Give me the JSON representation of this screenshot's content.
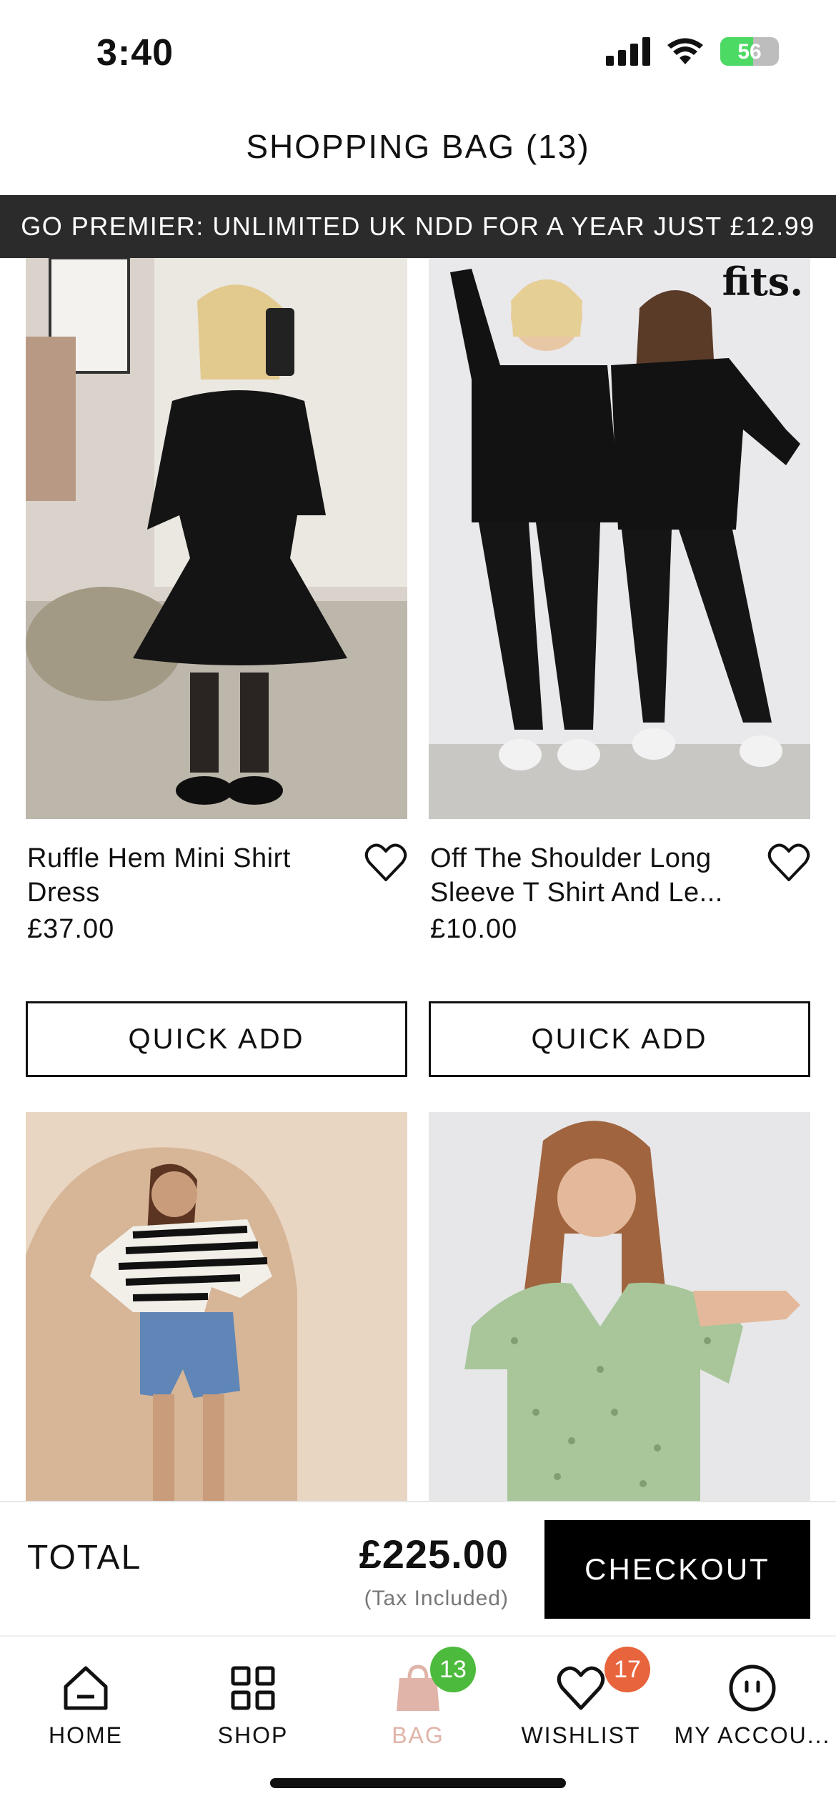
{
  "status": {
    "time": "3:40",
    "battery": "56"
  },
  "header": {
    "title": "SHOPPING BAG (13)"
  },
  "promo": {
    "text": "GO PREMIER: UNLIMITED UK NDD FOR A YEAR JUST £12.99"
  },
  "products": [
    {
      "name": "Ruffle Hem Mini Shirt Dress",
      "price": "£37.00",
      "button": "QUICK ADD"
    },
    {
      "name": "Off The Shoulder Long Sleeve T Shirt And Le...",
      "price": "£10.00",
      "button": "QUICK ADD",
      "brand_logo": "fits."
    },
    {
      "name": "",
      "price": ""
    },
    {
      "name": "",
      "price": ""
    }
  ],
  "footer": {
    "total_label": "TOTAL",
    "total_amount": "£225.00",
    "tax_note": "(Tax Included)",
    "checkout_label": "CHECKOUT"
  },
  "tabs": [
    {
      "label": "HOME",
      "icon": "home-icon"
    },
    {
      "label": "SHOP",
      "icon": "grid-icon"
    },
    {
      "label": "BAG",
      "icon": "bag-icon",
      "badge": "13",
      "active": true
    },
    {
      "label": "WISHLIST",
      "icon": "heart-icon",
      "badge": "17"
    },
    {
      "label": "MY ACCOU...",
      "icon": "account-icon"
    }
  ],
  "colors": {
    "promo_bg": "#2b2b2b",
    "bag_badge": "#4cba3c",
    "wishlist_badge": "#e8643c",
    "active_tab": "#e0b4a8"
  }
}
